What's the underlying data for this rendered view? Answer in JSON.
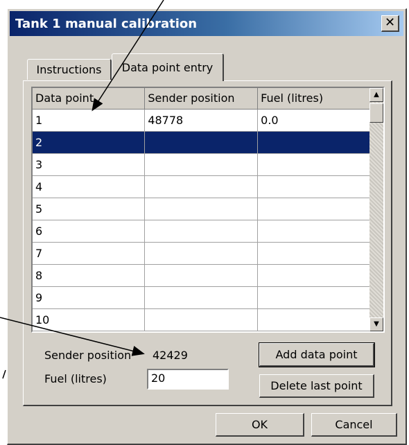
{
  "window": {
    "title": "Tank 1 manual calibration",
    "close_glyph": "✕"
  },
  "tabs": [
    {
      "label": "Instructions",
      "active": false
    },
    {
      "label": "Data point entry",
      "active": true
    }
  ],
  "table": {
    "columns": [
      "Data point",
      "Sender position",
      "Fuel (litres)"
    ],
    "rows": [
      [
        "1",
        "48778",
        "0.0"
      ],
      [
        "2",
        "",
        ""
      ],
      [
        "3",
        "",
        ""
      ],
      [
        "4",
        "",
        ""
      ],
      [
        "5",
        "",
        ""
      ],
      [
        "6",
        "",
        ""
      ],
      [
        "7",
        "",
        ""
      ],
      [
        "8",
        "",
        ""
      ],
      [
        "9",
        "",
        ""
      ],
      [
        "10",
        "",
        ""
      ]
    ],
    "selected_row": 1,
    "selection_color": "#0a246a"
  },
  "form": {
    "sender_position_label": "Sender position",
    "sender_position_value": "42429",
    "fuel_label": "Fuel (litres)",
    "fuel_value": "20"
  },
  "buttons": {
    "add": "Add data point",
    "delete": "Delete last point",
    "ok": "OK",
    "cancel": "Cancel"
  },
  "scrollbar": {
    "up_icon": "▲",
    "down_icon": "▼"
  }
}
